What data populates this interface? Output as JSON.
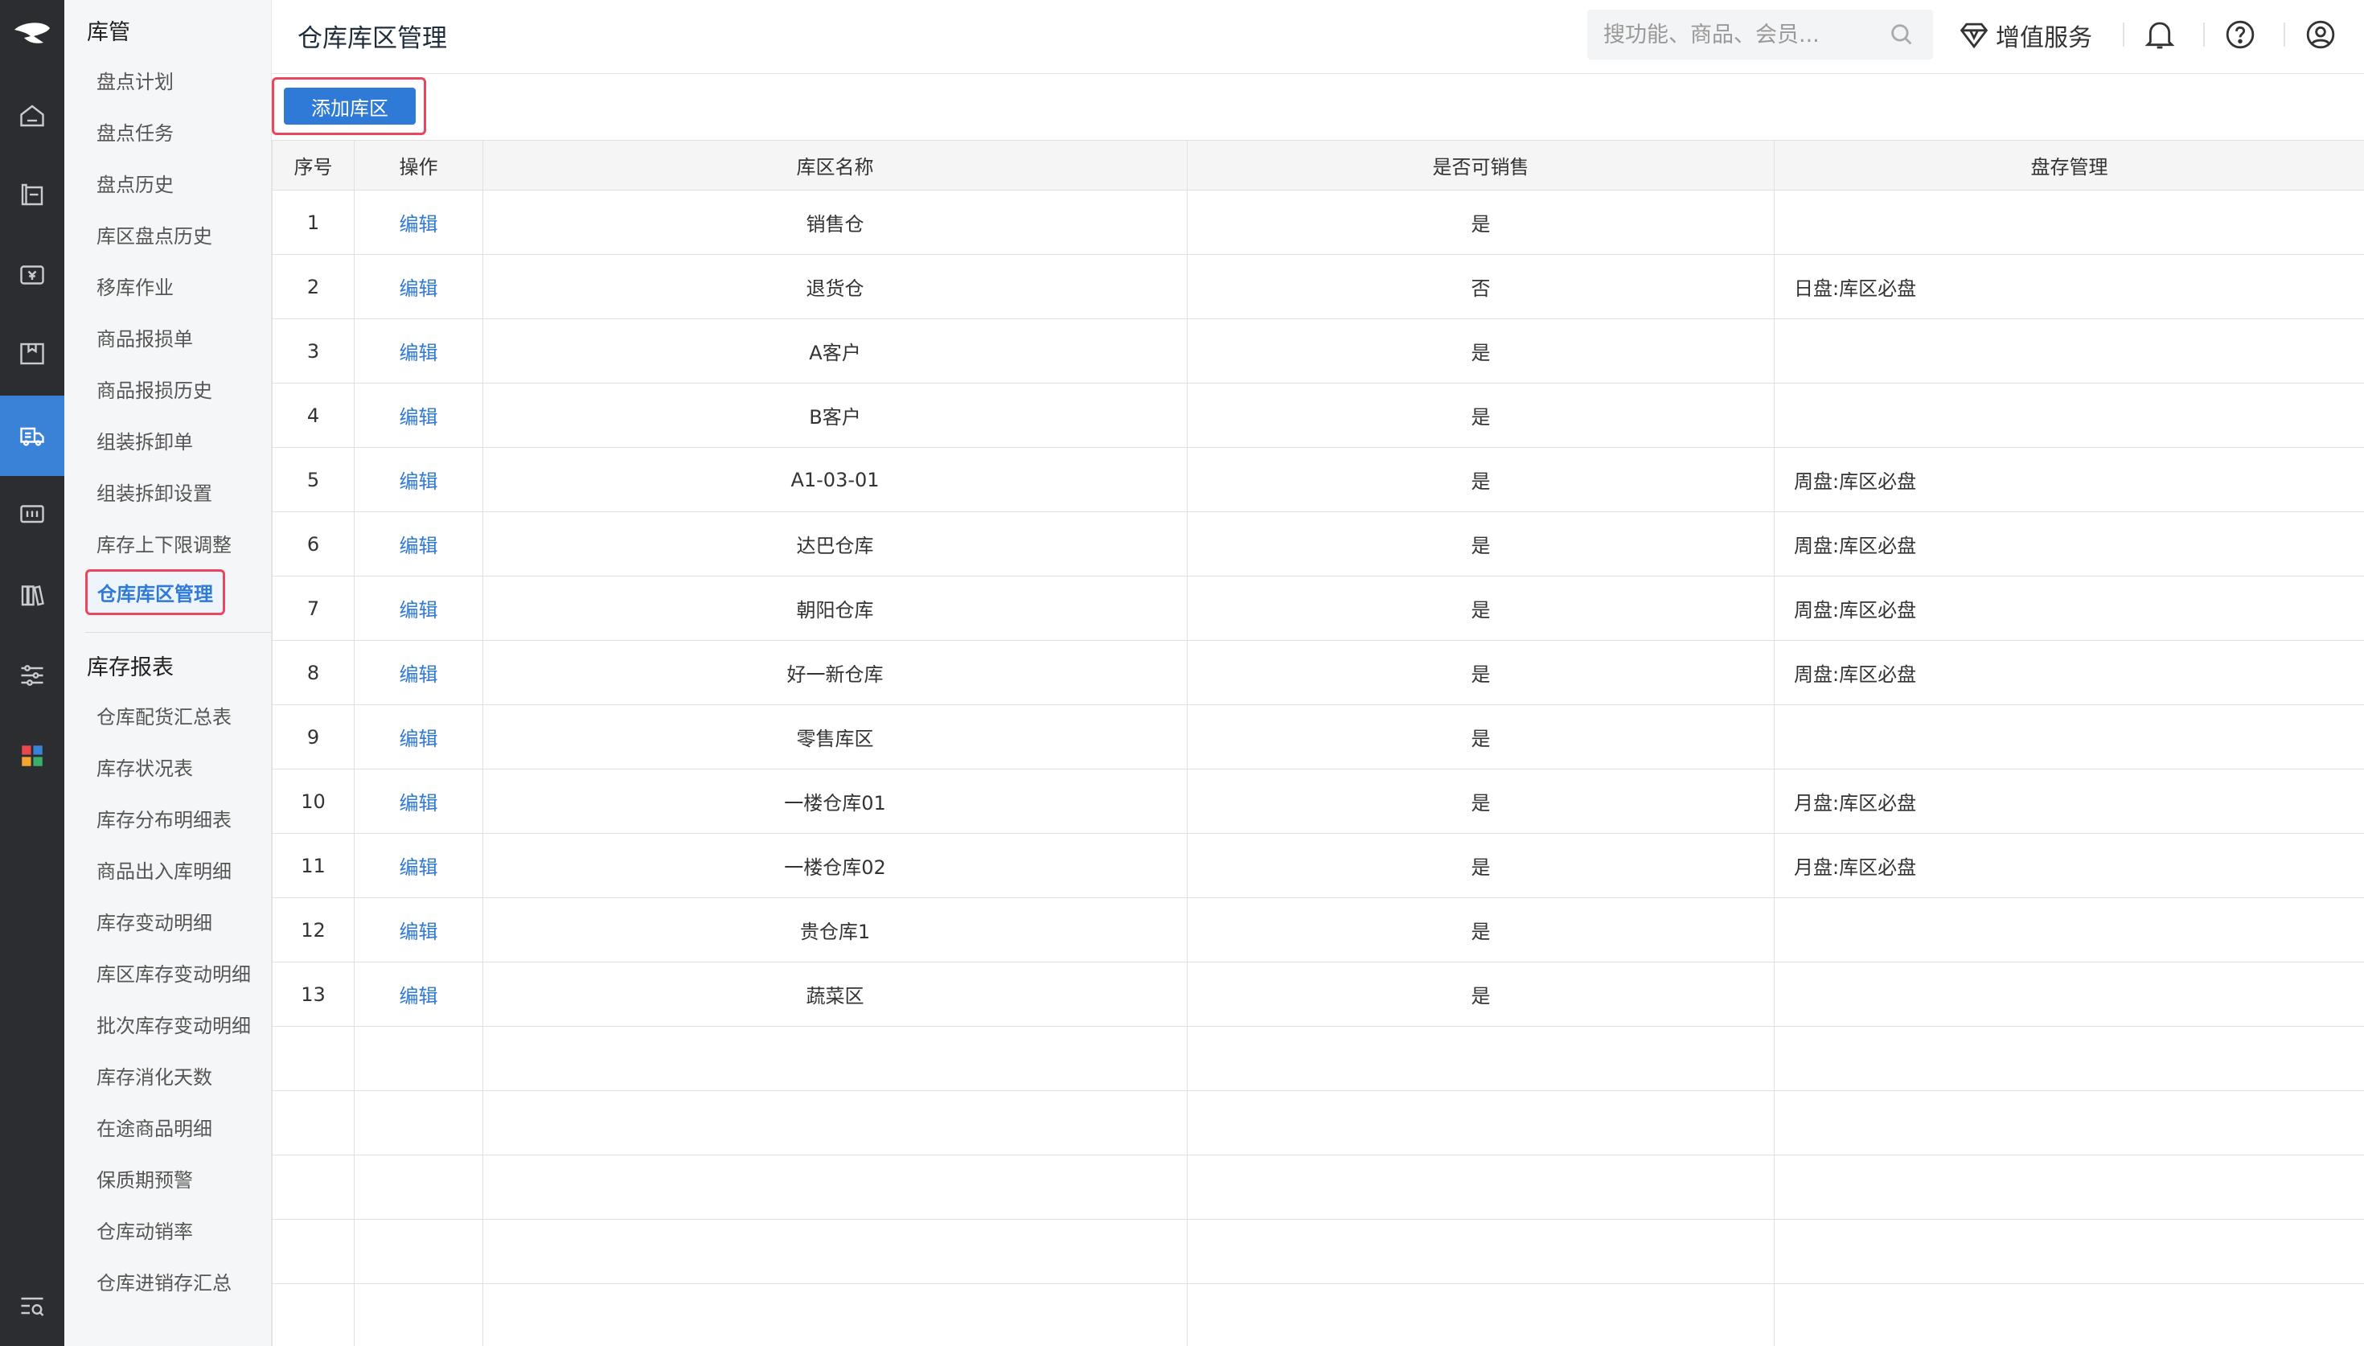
{
  "header": {
    "title": "仓库库区管理",
    "search_placeholder": "搜功能、商品、会员...",
    "value_added_label": "增值服务"
  },
  "sidebar": {
    "group1": "库管",
    "items1": [
      "盘点计划",
      "盘点任务",
      "盘点历史",
      "库区盘点历史",
      "移库作业",
      "商品报损单",
      "商品报损历史",
      "组装拆卸单",
      "组装拆卸设置",
      "库存上下限调整",
      "仓库库区管理"
    ],
    "group2": "库存报表",
    "items2": [
      "仓库配货汇总表",
      "库存状况表",
      "库存分布明细表",
      "商品出入库明细",
      "库存变动明细",
      "库区库存变动明细",
      "批次库存变动明细",
      "库存消化天数",
      "在途商品明细",
      "保质期预警",
      "仓库动销率",
      "仓库进销存汇总"
    ],
    "active_item": "仓库库区管理"
  },
  "toolbar": {
    "add_label": "添加库区"
  },
  "table": {
    "columns": [
      "序号",
      "操作",
      "库区名称",
      "是否可销售",
      "盘存管理"
    ],
    "rows": [
      {
        "no": "1",
        "action": "编辑",
        "name": "销售仓",
        "sellable": "是",
        "mgr": ""
      },
      {
        "no": "2",
        "action": "编辑",
        "name": "退货仓",
        "sellable": "否",
        "mgr": "日盘:库区必盘"
      },
      {
        "no": "3",
        "action": "编辑",
        "name": "A客户",
        "sellable": "是",
        "mgr": ""
      },
      {
        "no": "4",
        "action": "编辑",
        "name": "B客户",
        "sellable": "是",
        "mgr": ""
      },
      {
        "no": "5",
        "action": "编辑",
        "name": "A1-03-01",
        "sellable": "是",
        "mgr": "周盘:库区必盘"
      },
      {
        "no": "6",
        "action": "编辑",
        "name": "达巴仓库",
        "sellable": "是",
        "mgr": "周盘:库区必盘"
      },
      {
        "no": "7",
        "action": "编辑",
        "name": "朝阳仓库",
        "sellable": "是",
        "mgr": "周盘:库区必盘"
      },
      {
        "no": "8",
        "action": "编辑",
        "name": "好一新仓库",
        "sellable": "是",
        "mgr": "周盘:库区必盘"
      },
      {
        "no": "9",
        "action": "编辑",
        "name": "零售库区",
        "sellable": "是",
        "mgr": ""
      },
      {
        "no": "10",
        "action": "编辑",
        "name": "一楼仓库01",
        "sellable": "是",
        "mgr": "月盘:库区必盘"
      },
      {
        "no": "11",
        "action": "编辑",
        "name": "一楼仓库02",
        "sellable": "是",
        "mgr": "月盘:库区必盘"
      },
      {
        "no": "12",
        "action": "编辑",
        "name": "贵仓库1",
        "sellable": "是",
        "mgr": ""
      },
      {
        "no": "13",
        "action": "编辑",
        "name": "蔬菜区",
        "sellable": "是",
        "mgr": ""
      }
    ],
    "empty_rows": 5
  },
  "colors": {
    "accent": "#2f7ad6",
    "rail": "#2b2d31",
    "highlight": "#e8475d"
  }
}
